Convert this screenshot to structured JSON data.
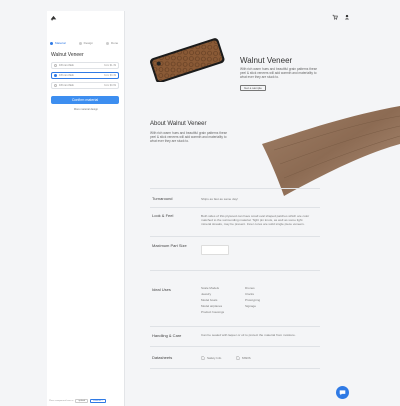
{
  "sidebar": {
    "tabs": [
      {
        "label": "Material"
      },
      {
        "label": "Design"
      },
      {
        "label": "Done"
      }
    ],
    "title": "Walnut Veneer",
    "options": [
      {
        "label": "0.8 mm thick",
        "price": "from $1.39"
      },
      {
        "label": "0.8 mm thick",
        "price": "from $0.49"
      },
      {
        "label": "0.8 mm thick",
        "price": "from $0.69"
      }
    ],
    "selected_option": 1,
    "confirm_label": "Confirm material",
    "more_link": "More material design",
    "footer": {
      "text": "Place component here or",
      "btn1": "upload",
      "btn2": "continue ›"
    }
  },
  "hero": {
    "title": "Walnut Veneer",
    "description": "With rich warm hues and beautiful grain patterns these peel & stick veneers will add warmth and materiality to what ever they are stuck to.",
    "button": "Get a sample"
  },
  "about": {
    "title": "About Walnut Veneer",
    "description": "With rich warm hues and beautiful grain patterns these peel & stick veneers will add warmth and materiality to what ever they are stuck to."
  },
  "specs": {
    "turnaround_label": "Turnaround",
    "turnaround_value": "Ships as fast as same day!",
    "look_label": "Look & Feel",
    "look_value": "Both sides of this plywood can have small oval shaped patches which are color matched to the surrounding material. Tight pin knots, as well as some light mineral streaks, may be present. Inner cores are solid single piece veneers.",
    "size_label": "Maximum Part Size",
    "uses_label": "Ideal Uses",
    "uses": [
      "Scale Models",
      "Drones",
      "Jewelry",
      "Clocks",
      "Model boats",
      "Prototyping",
      "Model airplanes",
      "Signage",
      "Product housings"
    ],
    "care_label": "Handling & Care",
    "care_value": "Can be sealed with laquer or oil to protect the material from moisture.",
    "datasheets_label": "Datasheets",
    "ds1": "Safety Info",
    "ds2": "MSDS"
  },
  "colors": {
    "accent": "#2f7ae5",
    "background": "#f4f5f7"
  }
}
